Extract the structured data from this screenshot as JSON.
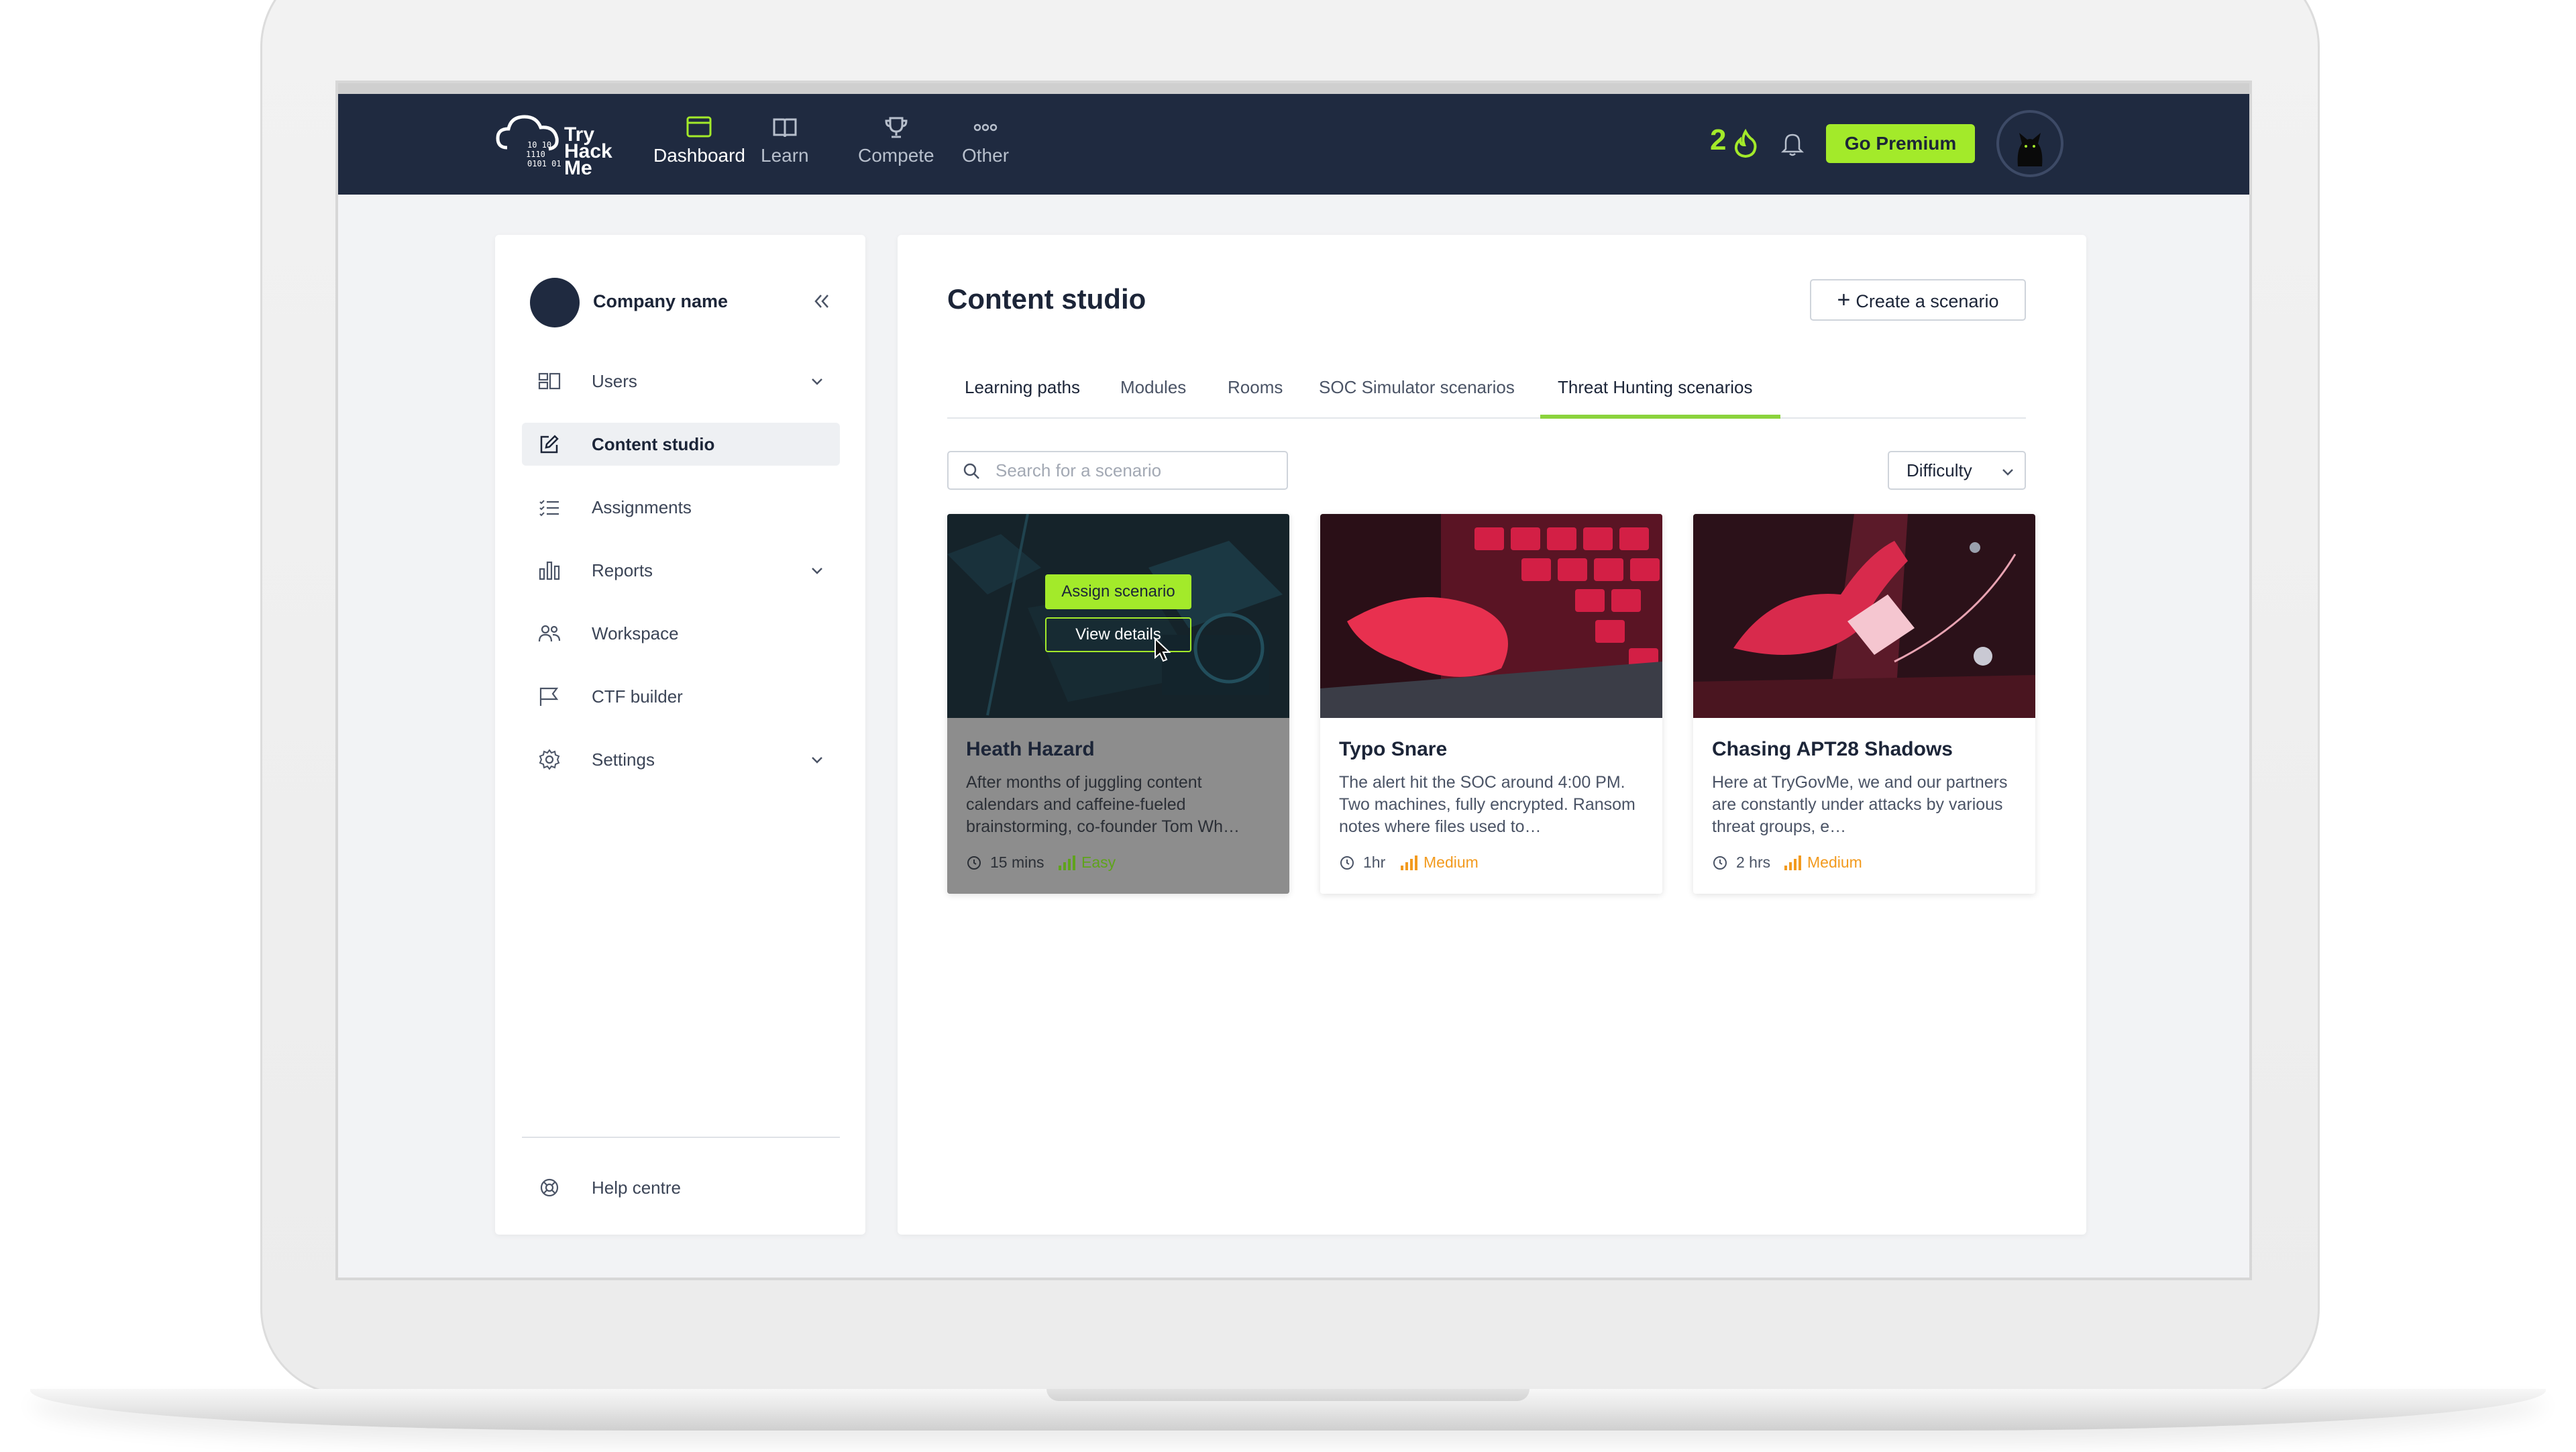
{
  "brand": {
    "logo_text": "Try Hack Me",
    "accent": "#a3ea2a",
    "nav_bg": "#1f2a40"
  },
  "topnav": {
    "items": [
      {
        "label": "Dashboard",
        "icon": "dashboard-icon",
        "active": true
      },
      {
        "label": "Learn",
        "icon": "book-icon",
        "active": false
      },
      {
        "label": "Compete",
        "icon": "trophy-icon",
        "active": false
      },
      {
        "label": "Other",
        "icon": "more-icon",
        "active": false
      }
    ],
    "streak": "2",
    "premium_label": "Go Premium"
  },
  "sidebar": {
    "company_name": "Company name",
    "items": [
      {
        "label": "Users",
        "icon": "users-icon",
        "expandable": true
      },
      {
        "label": "Content studio",
        "icon": "edit-icon",
        "active": true
      },
      {
        "label": "Assignments",
        "icon": "list-icon"
      },
      {
        "label": "Reports",
        "icon": "bar-chart-icon",
        "expandable": true
      },
      {
        "label": "Workspace",
        "icon": "team-icon"
      },
      {
        "label": "CTF builder",
        "icon": "flag-icon"
      },
      {
        "label": "Settings",
        "icon": "gear-icon",
        "expandable": true
      }
    ],
    "help_label": "Help centre"
  },
  "main": {
    "title": "Content studio",
    "create_label": "Create a scenario",
    "tabs": [
      {
        "label": "Learning paths"
      },
      {
        "label": "Modules"
      },
      {
        "label": "Rooms"
      },
      {
        "label": "SOC Simulator scenarios"
      },
      {
        "label": "Threat Hunting scenarios",
        "active": true
      }
    ],
    "search_placeholder": "Search for a scenario",
    "difficulty_label": "Difficulty",
    "cards": [
      {
        "title": "Heath Hazard",
        "description": "After months of juggling content calendars and caffeine-fueled brainstorming, co-founder Tom Wh…",
        "duration": "15 mins",
        "difficulty": "Easy",
        "hovered": true,
        "assign_label": "Assign scenario",
        "details_label": "View details"
      },
      {
        "title": "Typo Snare",
        "description": "The alert hit the SOC around 4:00 PM. Two machines, fully encrypted. Ransom notes where files used to…",
        "duration": "1hr",
        "difficulty": "Medium"
      },
      {
        "title": "Chasing APT28 Shadows",
        "description": "Here at TryGovMe, we and our partners are constantly under attacks by various threat groups, e…",
        "duration": "2 hrs",
        "difficulty": "Medium"
      }
    ]
  }
}
